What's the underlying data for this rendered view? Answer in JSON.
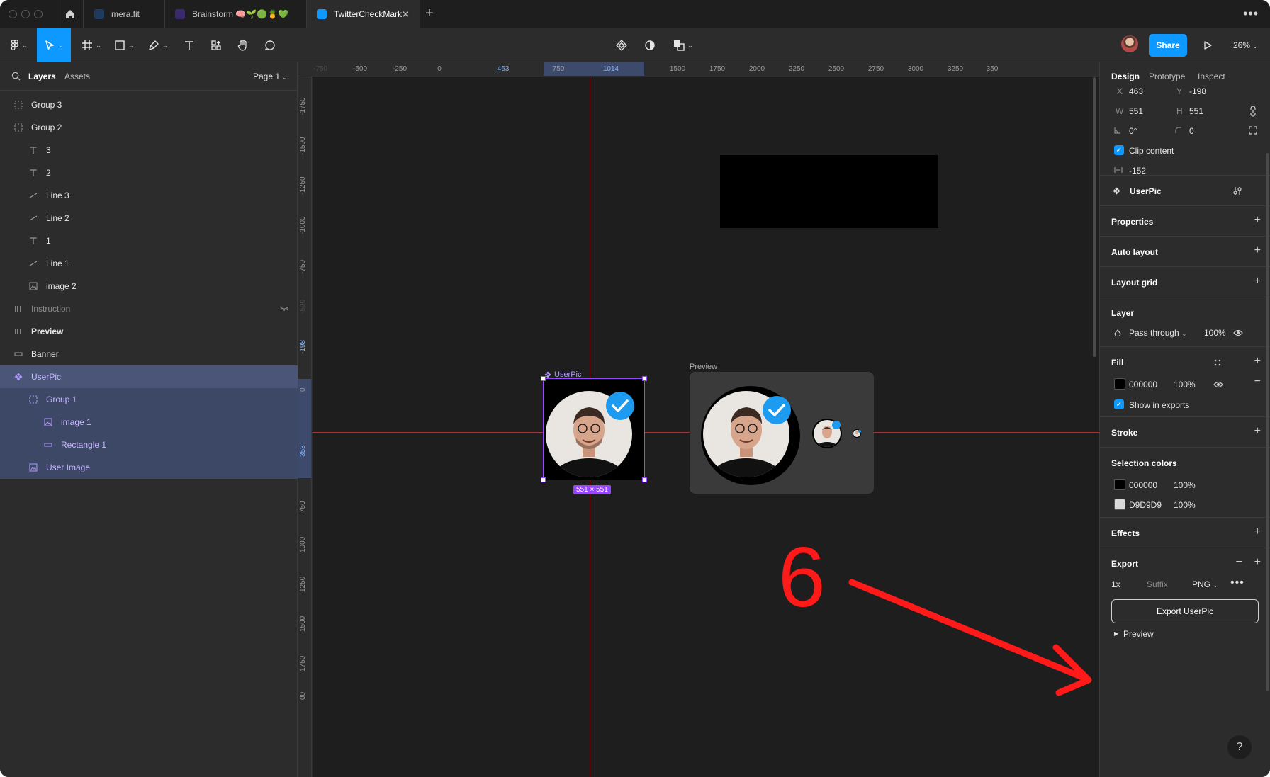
{
  "titlebar": {
    "tabs": [
      {
        "label": "mera.fit",
        "favicon_color": "#1f3a5f"
      },
      {
        "label": "Brainstorm 🧠🌱🟢🍍💚",
        "favicon_color": "#3b2a6b"
      },
      {
        "label": "TwitterCheckMark",
        "favicon_color": "#0d99ff"
      }
    ],
    "new_tab": "+",
    "more": "•••",
    "close_tab": "✕"
  },
  "toolbar": {
    "share_label": "Share",
    "zoom": "26%",
    "accent": "#0d99ff"
  },
  "left_panel": {
    "tabs": {
      "layers": "Layers",
      "assets": "Assets"
    },
    "page": "Page 1",
    "layers": [
      {
        "name": "Group 3",
        "icon": "group-icon",
        "indent": 0,
        "state": "normal"
      },
      {
        "name": "Group 2",
        "icon": "group-icon",
        "indent": 0,
        "state": "normal"
      },
      {
        "name": "3",
        "icon": "text-icon",
        "indent": 1,
        "state": "normal"
      },
      {
        "name": "2",
        "icon": "text-icon",
        "indent": 1,
        "state": "normal"
      },
      {
        "name": "Line 3",
        "icon": "line-icon",
        "indent": 1,
        "state": "normal"
      },
      {
        "name": "Line 2",
        "icon": "line-icon",
        "indent": 1,
        "state": "normal"
      },
      {
        "name": "1",
        "icon": "text-icon",
        "indent": 1,
        "state": "normal"
      },
      {
        "name": "Line 1",
        "icon": "line-icon",
        "indent": 1,
        "state": "normal"
      },
      {
        "name": "image 2",
        "icon": "image-icon",
        "indent": 1,
        "state": "normal"
      },
      {
        "name": "Instruction",
        "icon": "frame-icon",
        "indent": 0,
        "state": "hidden"
      },
      {
        "name": "Preview",
        "icon": "frame-icon",
        "indent": 0,
        "state": "bold"
      },
      {
        "name": "Banner",
        "icon": "rect-icon",
        "indent": 0,
        "state": "normal"
      },
      {
        "name": "UserPic",
        "icon": "component-icon",
        "indent": 0,
        "state": "selected"
      },
      {
        "name": "Group 1",
        "icon": "group-icon",
        "indent": 1,
        "state": "child"
      },
      {
        "name": "image 1",
        "icon": "image-icon",
        "indent": 2,
        "state": "child"
      },
      {
        "name": "Rectangle 1",
        "icon": "rect-icon",
        "indent": 2,
        "state": "child"
      },
      {
        "name": "User Image",
        "icon": "image-icon",
        "indent": 1,
        "state": "child"
      }
    ]
  },
  "rulers": {
    "top": [
      {
        "label": "-750",
        "faint": true
      },
      {
        "label": "-500"
      },
      {
        "label": "-250"
      },
      {
        "label": "0"
      },
      {
        "label": "463",
        "hl": true
      },
      {
        "label": "750"
      },
      {
        "label": "1014",
        "hl": true
      },
      {
        "label": "1500"
      },
      {
        "label": "1750"
      },
      {
        "label": "2000"
      },
      {
        "label": "2250"
      },
      {
        "label": "2500"
      },
      {
        "label": "2750"
      },
      {
        "label": "3000"
      },
      {
        "label": "3250"
      },
      {
        "label": "350"
      }
    ],
    "left": [
      {
        "label": "-1750"
      },
      {
        "label": "-1500"
      },
      {
        "label": "-1250"
      },
      {
        "label": "-1000"
      },
      {
        "label": "-750"
      },
      {
        "label": "-500",
        "faint": true
      },
      {
        "label": "-198",
        "hl": true
      },
      {
        "label": "0"
      },
      {
        "label": "353",
        "hl": true
      },
      {
        "label": "750"
      },
      {
        "label": "1000"
      },
      {
        "label": "1250"
      },
      {
        "label": "1500"
      },
      {
        "label": "1750"
      },
      {
        "label": "00"
      }
    ]
  },
  "canvas": {
    "userpic_label": "UserPic",
    "size_badge": "551 × 551",
    "preview_label": "Preview",
    "annotation_number": "6",
    "annotation_color": "#ff1a1a",
    "selection_color": "#9747ff",
    "verified_color": "#1d9bf0"
  },
  "right_panel": {
    "tabs": {
      "design": "Design",
      "prototype": "Prototype",
      "inspect": "Inspect"
    },
    "x_label": "X",
    "x": "463",
    "y_label": "Y",
    "y": "-198",
    "w_label": "W",
    "w": "551",
    "h_label": "H",
    "h": "551",
    "rotation": "0°",
    "radius": "0",
    "clip_content": "Clip content",
    "spacing": "-152",
    "component_name": "UserPic",
    "properties": "Properties",
    "auto_layout": "Auto layout",
    "layout_grid": "Layout grid",
    "layer_title": "Layer",
    "blend_mode": "Pass through",
    "layer_opacity": "100%",
    "fill_title": "Fill",
    "fill_hex": "000000",
    "fill_opacity": "100%",
    "show_in_exports": "Show in exports",
    "stroke": "Stroke",
    "selection_colors": "Selection colors",
    "sel_colors": [
      {
        "hex": "000000",
        "opacity": "100%",
        "color": "#000000"
      },
      {
        "hex": "D9D9D9",
        "opacity": "100%",
        "color": "#D9D9D9"
      }
    ],
    "effects": "Effects",
    "export_title": "Export",
    "export_scale": "1x",
    "export_suffix_placeholder": "Suffix",
    "export_format": "PNG",
    "export_button": "Export UserPic",
    "preview_toggle": "Preview",
    "help": "?"
  }
}
